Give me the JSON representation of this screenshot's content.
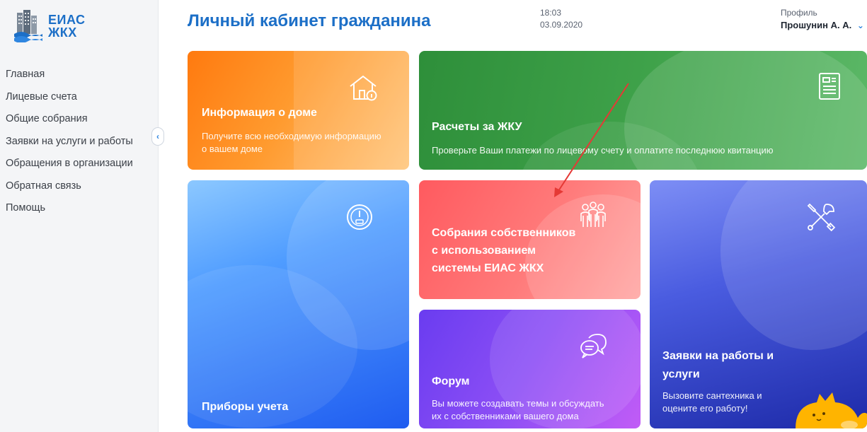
{
  "logo": {
    "line1": "ЕИАС",
    "line2": "ЖКХ"
  },
  "sidebar": {
    "items": [
      {
        "label": "Главная"
      },
      {
        "label": "Лицевые счета"
      },
      {
        "label": "Общие собрания"
      },
      {
        "label": "Заявки на услуги и работы"
      },
      {
        "label": "Обращения в организации"
      },
      {
        "label": "Обратная связь"
      },
      {
        "label": "Помощь"
      }
    ]
  },
  "header": {
    "title": "Личный кабинет гражданина",
    "time": "18:03",
    "date": "03.09.2020",
    "profile_caption": "Профиль",
    "profile_name": "Прошунин А. А."
  },
  "cards": {
    "info": {
      "title": "Информация о доме",
      "desc_line1": "Получите всю необходимую информацию",
      "desc_line2": "о вашем доме",
      "icon": "house-info-icon",
      "color": "#ff8a1f"
    },
    "bills": {
      "title": "Расчеты за ЖКУ",
      "desc": "Проверьте Ваши платежи по лицевому счету и оплатите последнюю квитанцию",
      "icon": "document-icon",
      "color": "#3a9a45"
    },
    "meters": {
      "title": "Приборы учета",
      "icon": "gauge-icon",
      "color": "#2f6cf2"
    },
    "meeting": {
      "title_line1": "Собрания собственников",
      "title_line2": "с использованием",
      "title_line3": "системы ЕИАС ЖКХ",
      "icon": "people-group-icon",
      "color": "#ff6b6b"
    },
    "forum": {
      "title": "Форум",
      "desc_line1": "Вы можете создавать темы и обсуждать",
      "desc_line2": "их с собственниками вашего дома",
      "icon": "chat-bubbles-icon",
      "color": "#8a4cf4"
    },
    "requests": {
      "title_line1": "Заявки на работы и",
      "title_line2": "услуги",
      "desc_line1": "Вызовите сантехника и",
      "desc_line2": "оцените его работу!",
      "icon": "tools-icon",
      "color": "#3446c9"
    }
  },
  "colors": {
    "accent": "#1c6fc7",
    "arrow": "#e53935"
  }
}
